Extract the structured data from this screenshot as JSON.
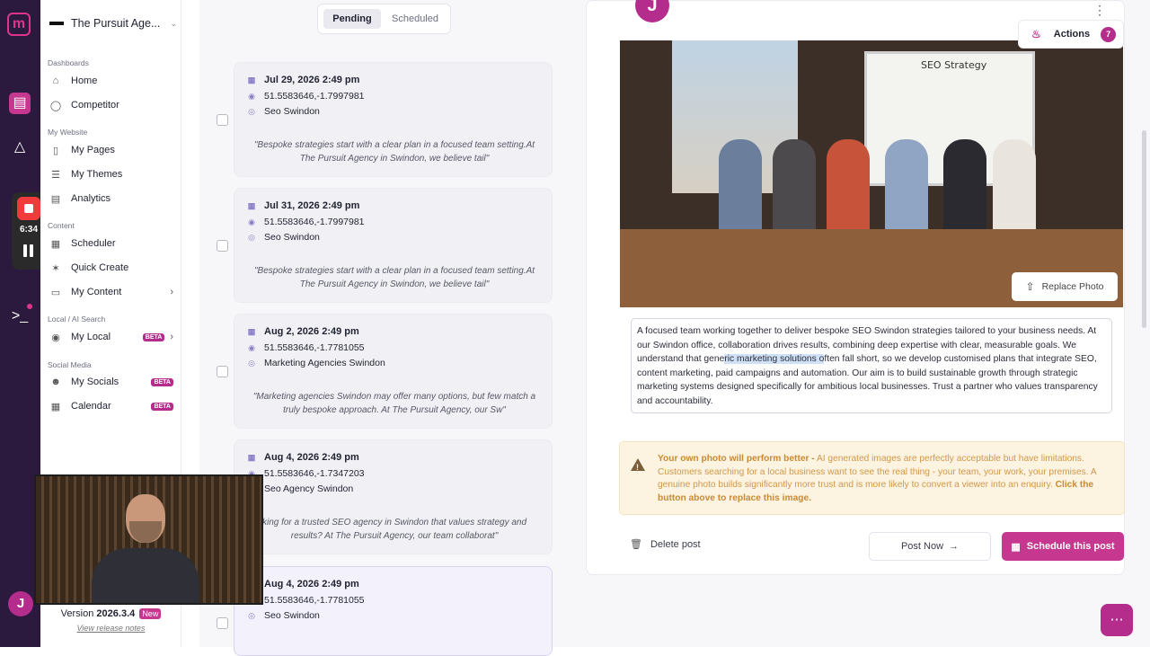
{
  "org_name": "The Pursuit Age...",
  "recorder": {
    "time": "6:34"
  },
  "sidebar": {
    "sections": [
      {
        "title": "Dashboards",
        "items": [
          {
            "label": "Home",
            "icon": "home-icon"
          },
          {
            "label": "Competitor",
            "icon": "target-icon"
          }
        ]
      },
      {
        "title": "My Website",
        "items": [
          {
            "label": "My Pages",
            "icon": "page-icon"
          },
          {
            "label": "My Themes",
            "icon": "list-icon"
          },
          {
            "label": "Analytics",
            "icon": "chart-icon"
          }
        ]
      },
      {
        "title": "Content",
        "items": [
          {
            "label": "Scheduler",
            "icon": "calendar-icon"
          },
          {
            "label": "Quick Create",
            "icon": "sparkle-icon"
          },
          {
            "label": "My Content",
            "icon": "folder-icon"
          }
        ]
      },
      {
        "title": "Local / AI Search",
        "items": [
          {
            "label": "My Local",
            "icon": "pin-icon",
            "badge": "BETA"
          }
        ]
      },
      {
        "title": "Social Media",
        "items": [
          {
            "label": "My Socials",
            "icon": "users-icon",
            "badge": "BETA"
          },
          {
            "label": "Calendar",
            "icon": "calendar-icon",
            "badge": "BETA"
          }
        ]
      }
    ],
    "version_label": "Version",
    "version": "2026.3.4",
    "version_badge": "New",
    "release_notes": "View release notes",
    "user_initial": "J"
  },
  "tabs": {
    "pending": "Pending",
    "scheduled": "Scheduled"
  },
  "posts": [
    {
      "date": "Jul 29, 2026 2:49 pm",
      "coords": "51.5583646,-1.7997981",
      "location": "Seo Swindon",
      "quote_l1": "\"Bespoke strategies start with a clear plan in a focused team setting.At",
      "quote_l2": "The Pursuit Agency in Swindon, we believe tail\""
    },
    {
      "date": "Jul 31, 2026 2:49 pm",
      "coords": "51.5583646,-1.7997981",
      "location": "Seo Swindon",
      "quote_l1": "\"Bespoke strategies start with a clear plan in a focused team setting.At",
      "quote_l2": "The Pursuit Agency in Swindon, we believe tail\""
    },
    {
      "date": "Aug 2, 2026 2:49 pm",
      "coords": "51.5583646,-1.7781055",
      "location": "Marketing Agencies Swindon",
      "quote_l1": "\"Marketing agencies Swindon may offer many options, but few match a",
      "quote_l2": "truly bespoke approach. At The Pursuit Agency, our Sw\""
    },
    {
      "date": "Aug 4, 2026 2:49 pm",
      "coords": "51.5583646,-1.7347203",
      "location": "Seo Agency Swindon",
      "quote_l1": "king for a trusted SEO agency in Swindon that values strategy and",
      "quote_l2": "results? At The Pursuit Agency, our team collaborat\""
    },
    {
      "date": "Aug 4, 2026 2:49 pm",
      "coords": "51.5583646,-1.7781055",
      "location": "Seo Swindon",
      "quote_l1": "",
      "quote_l2": ""
    }
  ],
  "detail": {
    "avatar_initial": "J",
    "board_title": "SEO Strategy",
    "replace_photo": "Replace Photo",
    "caption_before": "A focused team working together to deliver bespoke SEO Swindon strategies tailored to your business needs. At our Swindon office, collaboration drives results, combining deep expertise with clear, measurable goals. We understand that gene",
    "caption_highlight": "ric marketing solutions o",
    "caption_after": "ften fall short, so we develop customised plans that integrate SEO, content marketing, paid campaigns and automation. Our aim is to build sustainable growth through strategic marketing systems designed specifically for ambitious local businesses. Trust a partner who values transparency and accountability.",
    "notice_bold": "Your own photo will perform better -",
    "notice_text": " AI generated images are perfectly acceptable but have limitations. Customers searching for a local business want to see the real thing - your team, your work, your premises. A genuine photo builds significantly more trust and is more likely to convert a viewer into an enquiry. ",
    "notice_bold2": "Click the button above to replace this image.",
    "delete_post": "Delete post",
    "post_now": "Post Now",
    "schedule": "Schedule this post"
  },
  "actions": {
    "label": "Actions",
    "count": "7"
  },
  "colors": {
    "brand": "#c6378f",
    "rail": "#2b1a3d",
    "warning_bg": "#fdf3e1"
  }
}
